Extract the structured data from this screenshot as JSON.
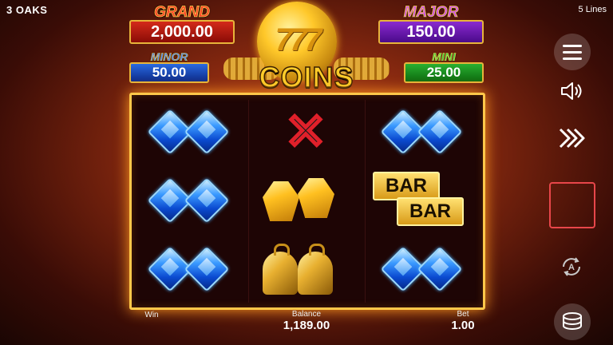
{
  "header": {
    "brand": "3 OAKS",
    "lines": "5 Lines"
  },
  "jackpots": {
    "grand": {
      "title": "GRAND",
      "value": "2,000.00"
    },
    "major": {
      "title": "MAJOR",
      "value": "150.00"
    },
    "minor": {
      "title": "MINOR",
      "value": "50.00"
    },
    "mini": {
      "title": "MINI",
      "value": "25.00"
    }
  },
  "logo": {
    "sevens": "777",
    "text": "COINS"
  },
  "reels": {
    "symbols": [
      [
        "blue-diamond",
        "blue-diamond",
        "blue-diamond"
      ],
      [
        "x-symbol",
        "gold-gem",
        "golden-bell"
      ],
      [
        "blue-diamond",
        "bar",
        "blue-diamond"
      ]
    ],
    "bar_labels": [
      "BAR",
      "BAR"
    ]
  },
  "footer": {
    "win_label": "Win",
    "balance_label": "Balance",
    "balance_value": "1,189.00",
    "bet_label": "Bet",
    "bet_value": "1.00"
  },
  "controls": [
    "menu-icon",
    "sound-icon",
    "turbo-icon",
    "spin-button",
    "autoplay-icon",
    "bet-coins-icon"
  ],
  "colors": {
    "frame": "#ffc84a",
    "spin_border": "#e8464a",
    "grand": "#d42a1a",
    "major": "#8a2ad0",
    "minor": "#2a6ae0",
    "mini": "#2ab030"
  }
}
